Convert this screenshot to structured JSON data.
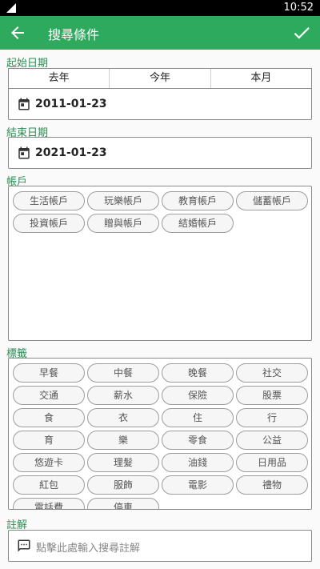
{
  "status_bar": {
    "time": "10:52"
  },
  "app_bar": {
    "title": "搜尋條件"
  },
  "start_date": {
    "label": "起始日期",
    "quick_options": [
      "去年",
      "今年",
      "本月"
    ],
    "value": "2011-01-23"
  },
  "end_date": {
    "label": "結束日期",
    "value": "2021-01-23"
  },
  "accounts": {
    "label": "帳戶",
    "items": [
      "生活帳戶",
      "玩樂帳戶",
      "教育帳戶",
      "儲蓄帳戶",
      "投資帳戶",
      "贈與帳戶",
      "結婚帳戶"
    ]
  },
  "tags": {
    "label": "標籤",
    "items": [
      "早餐",
      "中餐",
      "晚餐",
      "社交",
      "交通",
      "薪水",
      "保險",
      "股票",
      "食",
      "衣",
      "住",
      "行",
      "育",
      "樂",
      "零食",
      "公益",
      "悠遊卡",
      "理髮",
      "油錢",
      "日用品",
      "紅包",
      "服飾",
      "電影",
      "禮物",
      "電話費",
      "停車"
    ]
  },
  "note": {
    "label": "註解",
    "placeholder": "點擊此處輸入搜尋註解"
  },
  "colors": {
    "accent": "#2daa5e",
    "label": "#2a8f54"
  },
  "icons": {
    "back": "arrow-left-icon",
    "confirm": "check-icon",
    "calendar": "calendar-icon",
    "note": "chat-icon"
  }
}
